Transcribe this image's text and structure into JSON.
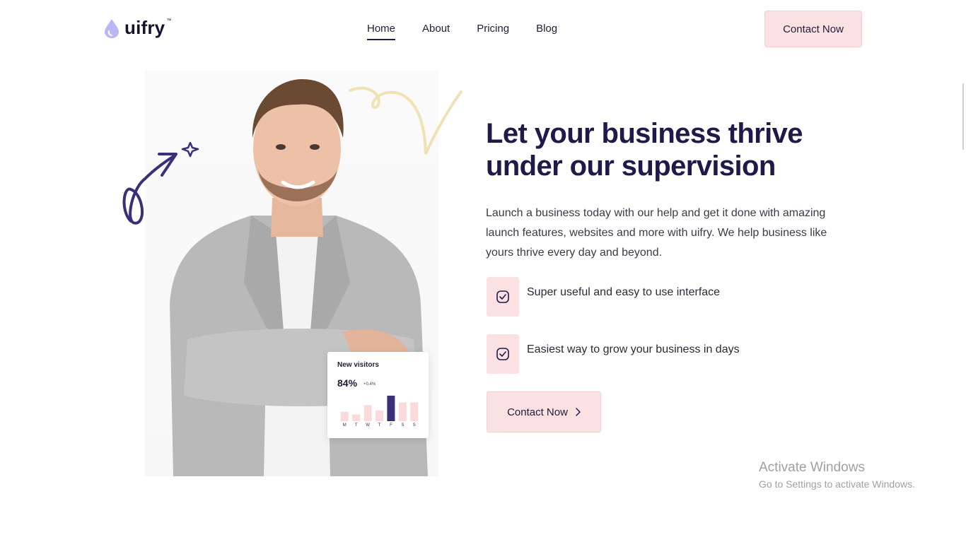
{
  "brand": {
    "name": "uifry",
    "tm": "™"
  },
  "nav": {
    "items": [
      {
        "label": "Home",
        "active": true
      },
      {
        "label": "About"
      },
      {
        "label": "Pricing"
      },
      {
        "label": "Blog"
      }
    ]
  },
  "header": {
    "cta_label": "Contact Now"
  },
  "hero": {
    "title": "Let your business thrive under our supervision",
    "description": "Launch a business today with our help and get it done with amazing launch features, websites and more with uifry. We help business like yours thrive every day and beyond.",
    "features": [
      "Super useful and easy to use interface",
      "Easiest way to grow your business in days"
    ],
    "cta_label": "Contact Now"
  },
  "visitors_card": {
    "title": "New visitors",
    "value": "84%",
    "delta": "+0.4%",
    "days": [
      "M",
      "T",
      "W",
      "T",
      "F",
      "S",
      "S"
    ],
    "bar_values": [
      0.35,
      0.25,
      0.6,
      0.4,
      0.95,
      0.7,
      0.7
    ],
    "highlight_index": 4
  },
  "colors": {
    "accent": "#1e1b4b",
    "pink": "#fce1e3",
    "bar_highlight": "#3b2f7a",
    "bar": "#fadadd",
    "squiggle": "#f1e2b6"
  },
  "watermark": {
    "line1": "Activate Windows",
    "line2": "Go to Settings to activate Windows."
  }
}
